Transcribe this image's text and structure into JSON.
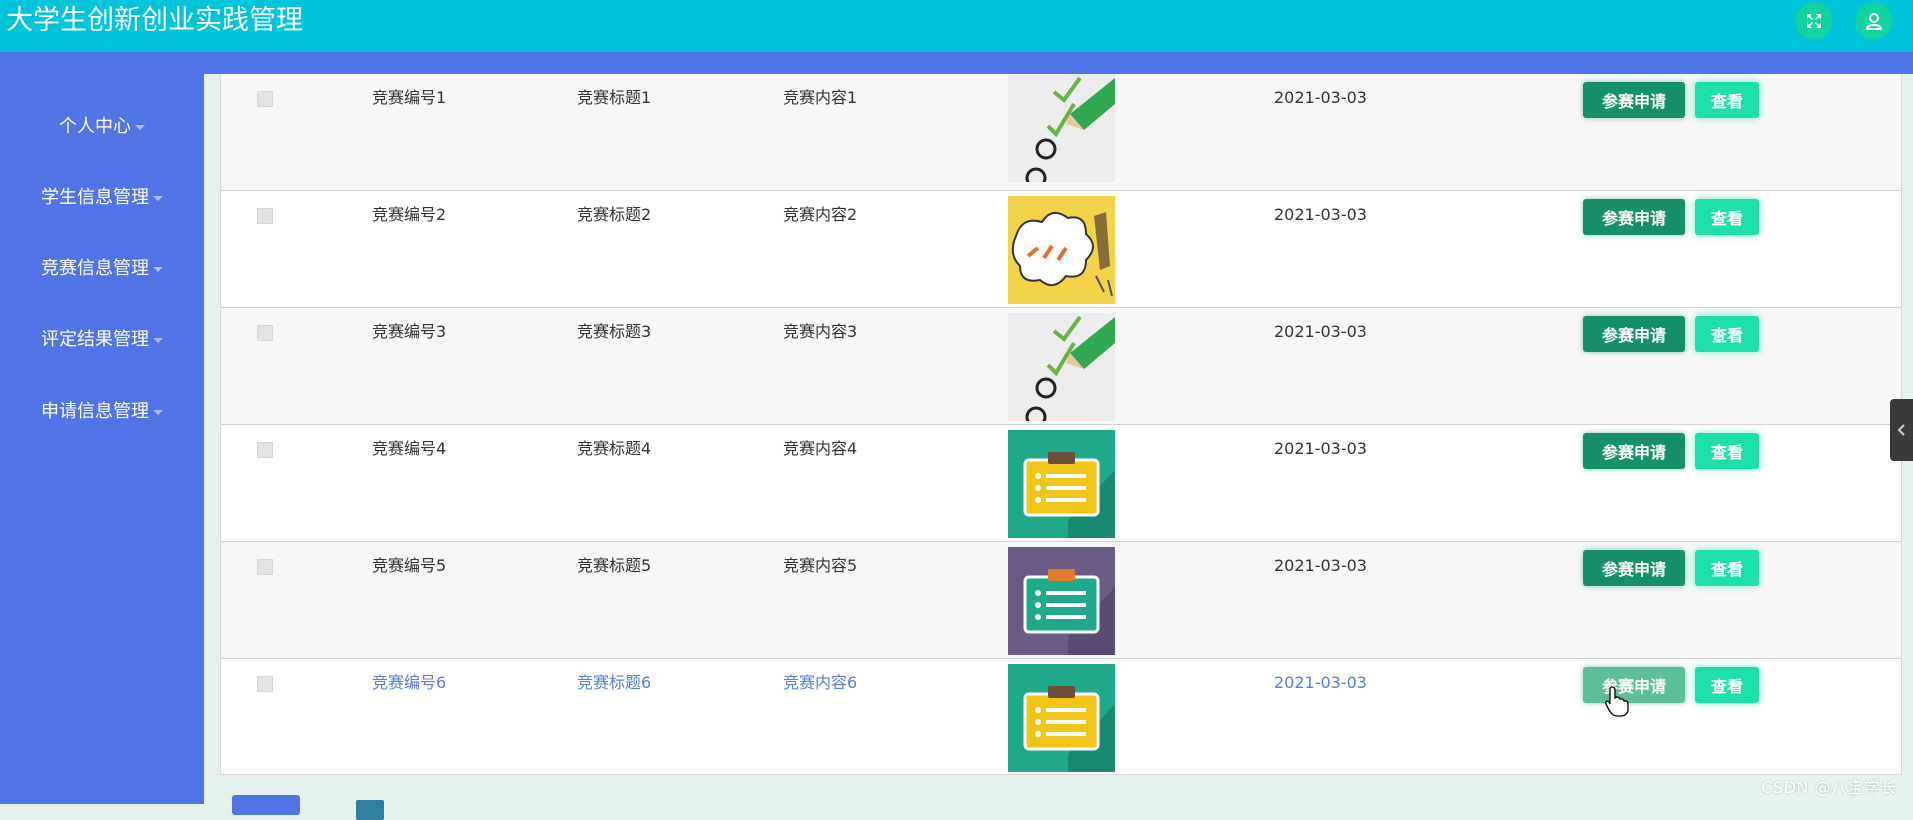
{
  "header": {
    "app_title": "大学生创新创业实践管理",
    "icons": [
      "fullscreen-icon",
      "user-icon"
    ],
    "bar_color": "#00c3dc"
  },
  "sidebar": {
    "background": "#4f74e6",
    "items": [
      {
        "label": "个人中心"
      },
      {
        "label": "学生信息管理"
      },
      {
        "label": "竞赛信息管理"
      },
      {
        "label": "评定结果管理"
      },
      {
        "label": "申请信息管理"
      }
    ]
  },
  "table": {
    "apply_label": "参赛申请",
    "view_label": "查看",
    "rows": [
      {
        "number": "竞赛编号1",
        "title": "竞赛标题1",
        "content": "竞赛内容1",
        "image": "checklist-pencil",
        "date": "2021-03-03"
      },
      {
        "number": "竞赛编号2",
        "title": "竞赛标题2",
        "content": "竞赛内容2",
        "image": "survey-cartoon",
        "date": "2021-03-03"
      },
      {
        "number": "竞赛编号3",
        "title": "竞赛标题3",
        "content": "竞赛内容3",
        "image": "checklist-pencil",
        "date": "2021-03-03"
      },
      {
        "number": "竞赛编号4",
        "title": "竞赛标题4",
        "content": "竞赛内容4",
        "image": "clipboard-green",
        "date": "2021-03-03"
      },
      {
        "number": "竞赛编号5",
        "title": "竞赛标题5",
        "content": "竞赛内容5",
        "image": "clipboard-purple",
        "date": "2021-03-03"
      },
      {
        "number": "竞赛编号6",
        "title": "竞赛标题6",
        "content": "竞赛内容6",
        "image": "clipboard-green",
        "date": "2021-03-03"
      }
    ]
  },
  "watermark": "CSDN @八宝学长",
  "colors": {
    "apply_button": "#15906a",
    "view_button": "#1ddfa9",
    "hover_text": "#5b7bd5"
  }
}
